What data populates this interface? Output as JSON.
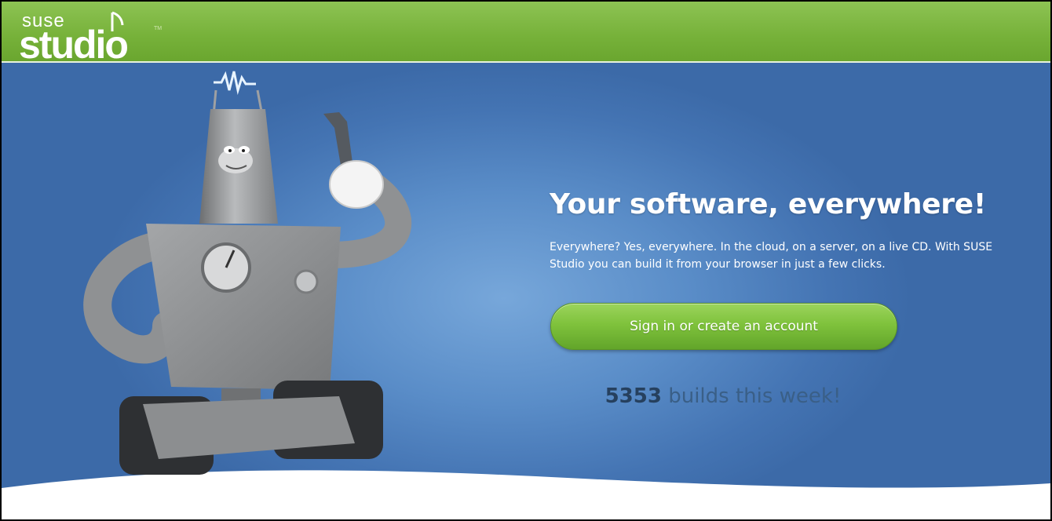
{
  "header": {
    "logo_small": "suse",
    "logo_large": "studio",
    "logo_mark": "TM"
  },
  "hero": {
    "headline": "Your software, everywhere!",
    "description": "Everywhere? Yes, everywhere. In the cloud, on a server, on a live CD. With SUSE Studio you can build it from your browser in just a few clicks.",
    "cta_label": "Sign in or create an account",
    "build_count": "5353",
    "build_suffix": " builds this week!",
    "illustration": "robot-with-wrench-illustration"
  },
  "colors": {
    "header_green": "#7ab83e",
    "hero_blue": "#4a7cbc",
    "button_green": "#7fc23c",
    "count_text": "#3a5f87"
  }
}
